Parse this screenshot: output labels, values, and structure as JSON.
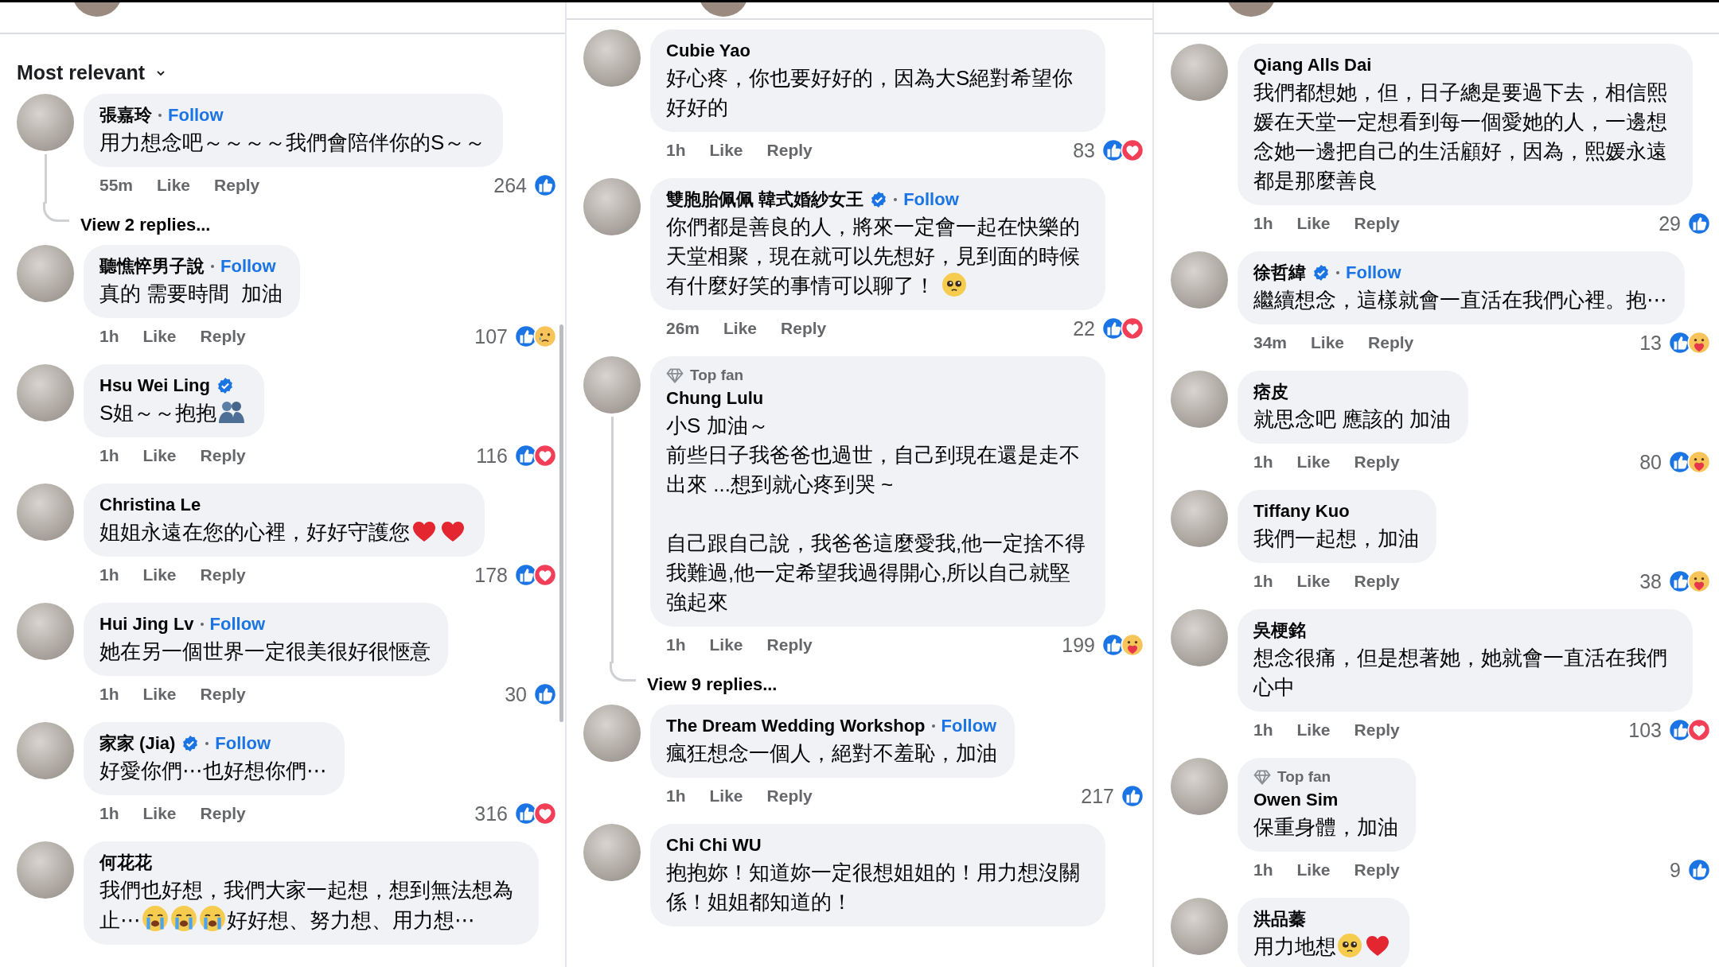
{
  "columns": [
    {
      "sort": {
        "label": "Most relevant"
      },
      "comments": [
        {
          "name": "張嘉玲",
          "follow": "Follow",
          "body": [
            {
              "kind": "text",
              "text": "用力想念吧～～～～我們會陪伴你的S～～"
            }
          ],
          "time": "55m",
          "like": "Like",
          "reply": "Reply",
          "count": "264",
          "reactions": [
            {
              "kind": "like"
            }
          ],
          "replies": "View 2 replies..."
        },
        {
          "name": "聽憔悴男子說",
          "follow": "Follow",
          "body": [
            {
              "kind": "text",
              "text": "真的 需要時間  加油"
            }
          ],
          "time": "1h",
          "like": "Like",
          "reply": "Reply",
          "count": "107",
          "reactions": [
            {
              "kind": "like"
            },
            {
              "kind": "sad"
            }
          ]
        },
        {
          "name": "Hsu Wei Ling",
          "verified": true,
          "body": [
            {
              "kind": "text",
              "text": "S姐～～抱抱"
            },
            {
              "kind": "hug"
            }
          ],
          "time": "1h",
          "like": "Like",
          "reply": "Reply",
          "count": "116",
          "reactions": [
            {
              "kind": "like"
            },
            {
              "kind": "love"
            }
          ]
        },
        {
          "name": "Christina Le",
          "body": [
            {
              "kind": "text",
              "text": "姐姐永遠在您的心裡，好好守護您"
            },
            {
              "kind": "heart"
            },
            {
              "kind": "heart"
            }
          ],
          "time": "1h",
          "like": "Like",
          "reply": "Reply",
          "count": "178",
          "reactions": [
            {
              "kind": "like"
            },
            {
              "kind": "love"
            }
          ]
        },
        {
          "name": "Hui Jing Lv",
          "follow": "Follow",
          "body": [
            {
              "kind": "text",
              "text": "她在另一個世界一定很美很好很愜意"
            }
          ],
          "time": "1h",
          "like": "Like",
          "reply": "Reply",
          "count": "30",
          "reactions": [
            {
              "kind": "like"
            }
          ]
        },
        {
          "name": "家家 (Jia)",
          "verified": true,
          "follow": "Follow",
          "body": [
            {
              "kind": "text",
              "text": "好愛你們⋯也好想你們⋯"
            }
          ],
          "time": "1h",
          "like": "Like",
          "reply": "Reply",
          "count": "316",
          "reactions": [
            {
              "kind": "like"
            },
            {
              "kind": "love"
            }
          ]
        },
        {
          "name": "何花花",
          "body": [
            {
              "kind": "text",
              "text": "我們也好想，我們大家一起想，想到無法想為止⋯"
            },
            {
              "kind": "crying"
            },
            {
              "kind": "crying"
            },
            {
              "kind": "crying"
            },
            {
              "kind": "text",
              "text": "好好想、努力想、用力想⋯"
            }
          ]
        }
      ]
    },
    {
      "comments": [
        {
          "name": "Cubie Yao",
          "body": [
            {
              "kind": "text",
              "text": "好心疼，你也要好好的，因為大S絕對希望你好好的"
            }
          ],
          "time": "1h",
          "like": "Like",
          "reply": "Reply",
          "count": "83",
          "reactions": [
            {
              "kind": "like"
            },
            {
              "kind": "love"
            }
          ]
        },
        {
          "name": "雙胞胎佩佩  韓式婚紗女王",
          "verified": true,
          "follow": "Follow",
          "body": [
            {
              "kind": "text",
              "text": "你們都是善良的人，將來一定會一起在快樂的天堂相聚，現在就可以先想好，見到面的時候有什麼好笑的事情可以聊了！ "
            },
            {
              "kind": "pleading"
            }
          ],
          "time": "26m",
          "like": "Like",
          "reply": "Reply",
          "count": "22",
          "reactions": [
            {
              "kind": "like"
            },
            {
              "kind": "love"
            }
          ]
        },
        {
          "top_fan": "Top fan",
          "name": "Chung Lulu",
          "body": [
            {
              "kind": "text",
              "text": "小S 加油～"
            },
            {
              "kind": "line",
              "text": "前些日子我爸爸也過世，自己到現在還是走不出來 ...想到就心疼到哭 ~"
            },
            {
              "kind": "paragraph",
              "text": "自己跟自己說，我爸爸這麼愛我,他一定捨不得我難過,他一定希望我過得開心,所以自己就堅強起來"
            }
          ],
          "time": "1h",
          "like": "Like",
          "reply": "Reply",
          "count": "199",
          "reactions": [
            {
              "kind": "like"
            },
            {
              "kind": "care"
            }
          ],
          "replies": "View 9 replies..."
        },
        {
          "name": "The Dream Wedding Workshop",
          "follow": "Follow",
          "body": [
            {
              "kind": "text",
              "text": "瘋狂想念一個人，絕對不羞恥，加油"
            }
          ],
          "time": "1h",
          "like": "Like",
          "reply": "Reply",
          "count": "217",
          "reactions": [
            {
              "kind": "like"
            }
          ]
        },
        {
          "name": "Chi Chi WU",
          "body": [
            {
              "kind": "text",
              "text": "抱抱妳！知道妳一定很想姐姐的！用力想沒關係！姐姐都知道的！"
            }
          ]
        }
      ]
    },
    {
      "comments": [
        {
          "name": "Qiang Alls Dai",
          "body": [
            {
              "kind": "text",
              "text": "我們都想她，但，日子總是要過下去，相信熙媛在天堂一定想看到每一個愛她的人，一邊想念她一邊把自己的生活顧好，因為，熙媛永遠都是那麼善良"
            }
          ],
          "time": "1h",
          "like": "Like",
          "reply": "Reply",
          "count": "29",
          "reactions": [
            {
              "kind": "like"
            }
          ]
        },
        {
          "name": "徐哲緯",
          "verified": true,
          "follow": "Follow",
          "body": [
            {
              "kind": "text",
              "text": "繼續想念，這樣就會一直活在我們心裡。抱⋯"
            }
          ],
          "time": "34m",
          "like": "Like",
          "reply": "Reply",
          "count": "13",
          "reactions": [
            {
              "kind": "like"
            },
            {
              "kind": "care"
            }
          ]
        },
        {
          "name": "痞皮",
          "body": [
            {
              "kind": "text",
              "text": "就思念吧 應該的 加油"
            }
          ],
          "time": "1h",
          "like": "Like",
          "reply": "Reply",
          "count": "80",
          "reactions": [
            {
              "kind": "like"
            },
            {
              "kind": "care"
            }
          ]
        },
        {
          "name": "Tiffany Kuo",
          "body": [
            {
              "kind": "text",
              "text": "我們一起想，加油"
            }
          ],
          "time": "1h",
          "like": "Like",
          "reply": "Reply",
          "count": "38",
          "reactions": [
            {
              "kind": "like"
            },
            {
              "kind": "care"
            }
          ]
        },
        {
          "name": "吳梗銘",
          "body": [
            {
              "kind": "text",
              "text": "想念很痛，但是想著她，她就會一直活在我們心中"
            }
          ],
          "time": "1h",
          "like": "Like",
          "reply": "Reply",
          "count": "103",
          "reactions": [
            {
              "kind": "like"
            },
            {
              "kind": "love"
            }
          ]
        },
        {
          "top_fan": "Top fan",
          "name": "Owen Sim",
          "body": [
            {
              "kind": "text",
              "text": "保重身體，加油"
            }
          ],
          "time": "1h",
          "like": "Like",
          "reply": "Reply",
          "count": "9",
          "reactions": [
            {
              "kind": "like"
            }
          ]
        },
        {
          "name": "洪品蓁",
          "body": [
            {
              "kind": "text",
              "text": "用力地想"
            },
            {
              "kind": "pleading"
            },
            {
              "kind": "heart"
            }
          ]
        }
      ]
    }
  ]
}
